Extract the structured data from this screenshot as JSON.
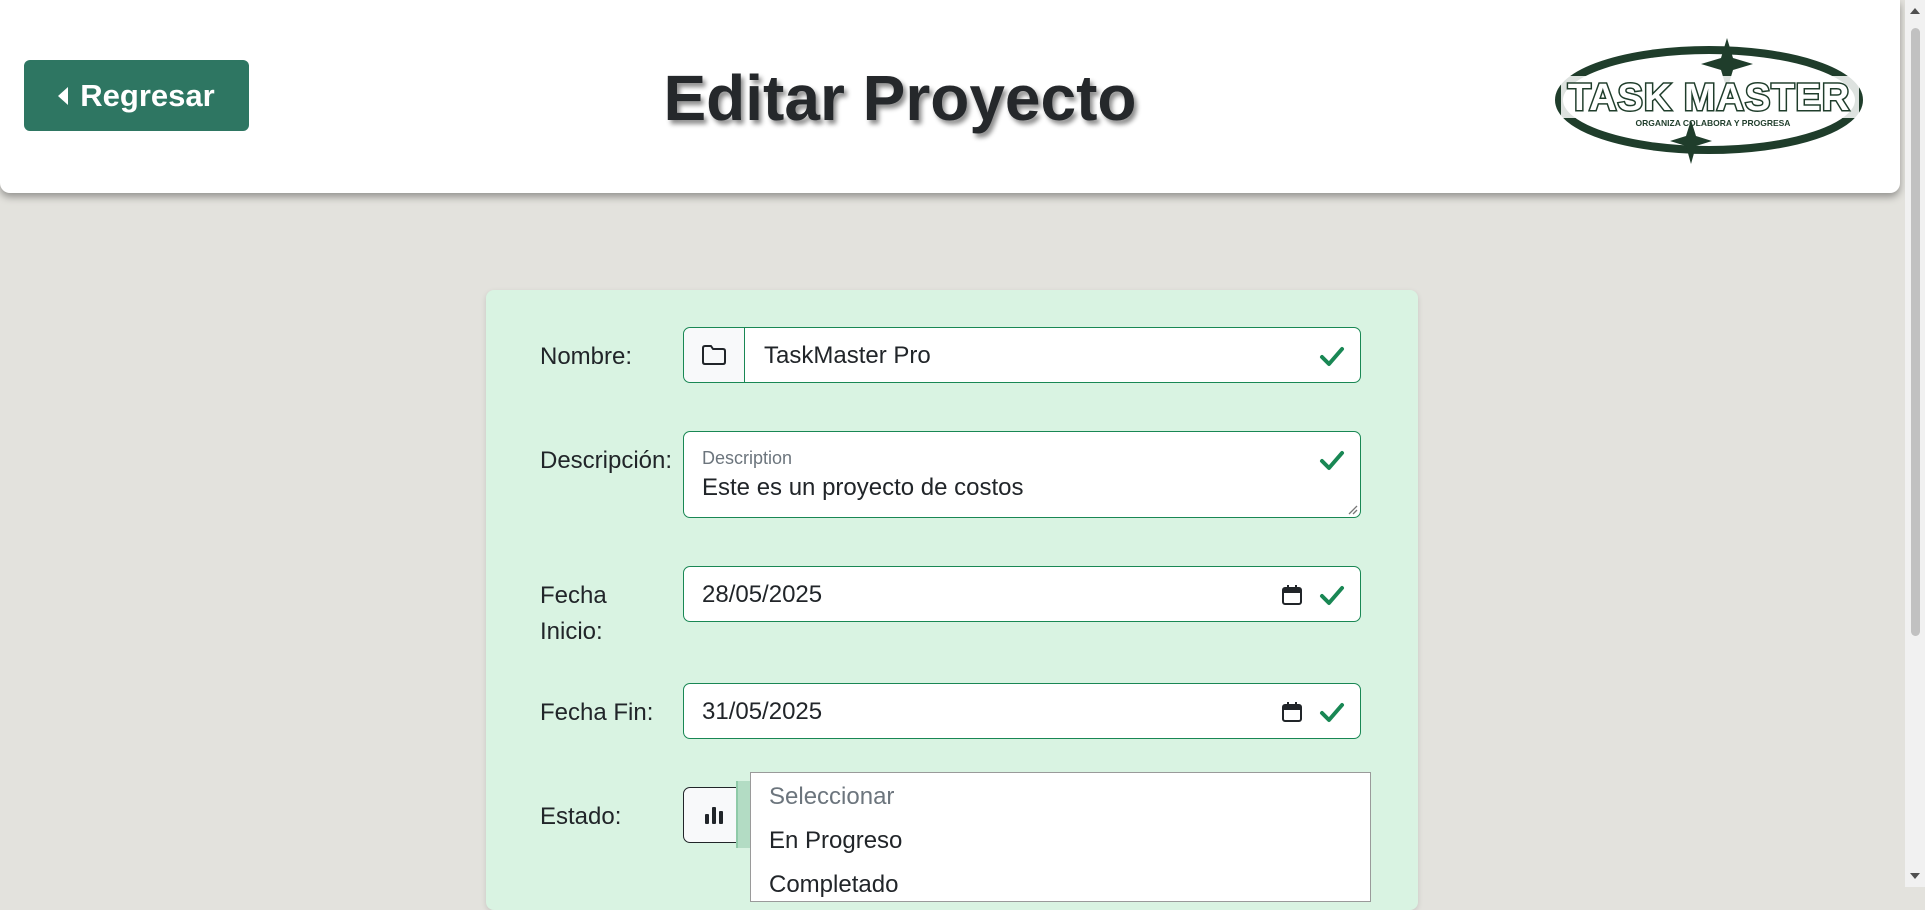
{
  "header": {
    "back_label": "Regresar",
    "title": "Editar Proyecto",
    "logo": {
      "name": "TASK MASTER",
      "tagline": "ORGANIZA COLABORA Y PROGRESA"
    }
  },
  "form": {
    "nombre": {
      "label": "Nombre:",
      "value": "TaskMaster Pro",
      "icon": "folder-icon"
    },
    "descripcion": {
      "label": "Descripción:",
      "floating_label": "Description",
      "value": "Este es un proyecto de costos"
    },
    "fecha_inicio": {
      "label_line1": "Fecha",
      "label_line2": "Inicio:",
      "value": "28/05/2025"
    },
    "fecha_fin": {
      "label": "Fecha Fin:",
      "value": "31/05/2025"
    },
    "estado": {
      "label": "Estado:",
      "icon": "bar-chart-icon",
      "options": [
        "Seleccionar",
        "En Progreso",
        "Completado"
      ]
    }
  },
  "colors": {
    "accent": "#2e7662",
    "valid": "#198754",
    "card_background": "#d9f3e2",
    "page_background": "#e3e2dd"
  }
}
